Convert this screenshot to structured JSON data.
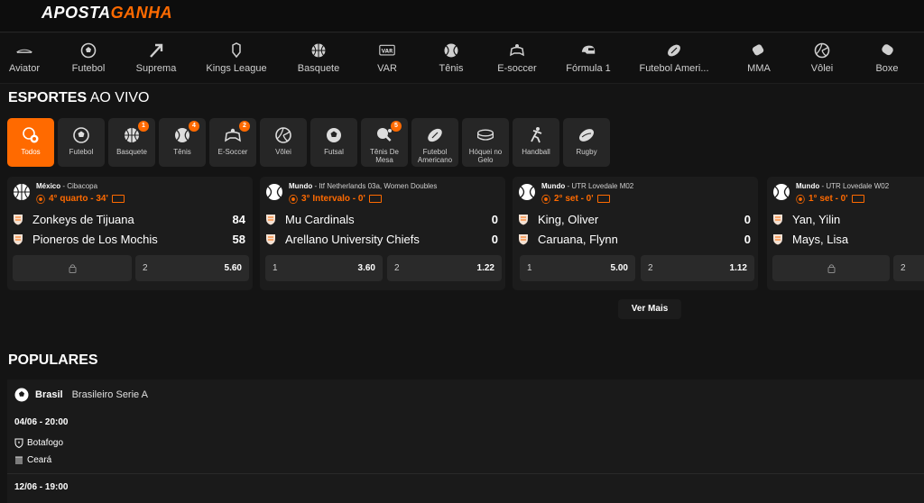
{
  "brand": {
    "part1": "APOSTA",
    "part2": "GANHA"
  },
  "colors": {
    "accent": "#ff6a00",
    "background": "#141414",
    "card": "#1c1c1c"
  },
  "nav": [
    {
      "label": "Aviator",
      "icon": "plane-icon"
    },
    {
      "label": "Futebol",
      "icon": "soccer-ball-icon"
    },
    {
      "label": "Suprema",
      "icon": "arrow-up-icon"
    },
    {
      "label": "Kings League",
      "icon": "kings-league-icon"
    },
    {
      "label": "Basquete",
      "icon": "basketball-icon"
    },
    {
      "label": "VAR",
      "icon": "var-icon"
    },
    {
      "label": "Tênis",
      "icon": "tennis-ball-icon"
    },
    {
      "label": "E-soccer",
      "icon": "gamepad-icon"
    },
    {
      "label": "Fórmula 1",
      "icon": "helmet-icon"
    },
    {
      "label": "Futebol Ameri...",
      "icon": "american-football-icon"
    },
    {
      "label": "MMA",
      "icon": "glove-icon"
    },
    {
      "label": "Vôlei",
      "icon": "volleyball-icon"
    },
    {
      "label": "Boxe",
      "icon": "boxing-glove-icon"
    }
  ],
  "live": {
    "title_bold": "ESPORTES",
    "title_rest": " AO VIVO"
  },
  "chips": [
    {
      "label": "Todos",
      "badge": ""
    },
    {
      "label": "Futebol",
      "badge": ""
    },
    {
      "label": "Basquete",
      "badge": "1"
    },
    {
      "label": "Tênis",
      "badge": "4"
    },
    {
      "label": "E-Soccer",
      "badge": "2"
    },
    {
      "label": "Vôlei",
      "badge": ""
    },
    {
      "label": "Futsal",
      "badge": ""
    },
    {
      "label": "Tênis De Mesa",
      "badge": "5"
    },
    {
      "label": "Futebol Americano",
      "badge": ""
    },
    {
      "label": "Hóquei no Gelo",
      "badge": ""
    },
    {
      "label": "Handball",
      "badge": ""
    },
    {
      "label": "Rugby",
      "badge": ""
    }
  ],
  "matches": [
    {
      "country": "México",
      "league": " - Cibacopa",
      "time": "4° quarto - 34'",
      "team1": "Zonkeys de Tijuana",
      "score1": "84",
      "team2": "Pioneros de Los Mochis",
      "score2": "58",
      "odd1": {
        "locked": true,
        "k": "",
        "v": ""
      },
      "odd2": {
        "locked": false,
        "k": "2",
        "v": "5.60"
      }
    },
    {
      "country": "Mundo",
      "league": " - Itf Netherlands 03a, Women Doubles",
      "time": "3° Intervalo - 0'",
      "team1": "Mu Cardinals",
      "score1": "0",
      "team2": "Arellano University Chiefs",
      "score2": "0",
      "odd1": {
        "locked": false,
        "k": "1",
        "v": "3.60"
      },
      "odd2": {
        "locked": false,
        "k": "2",
        "v": "1.22"
      }
    },
    {
      "country": "Mundo",
      "league": " - UTR Lovedale M02",
      "time": "2° set - 0'",
      "team1": "King, Oliver",
      "score1": "0",
      "team2": "Caruana, Flynn",
      "score2": "0",
      "odd1": {
        "locked": false,
        "k": "1",
        "v": "5.00"
      },
      "odd2": {
        "locked": false,
        "k": "2",
        "v": "1.12"
      }
    },
    {
      "country": "Mundo",
      "league": " - UTR Lovedale W02",
      "time": "1° set - 0'",
      "team1": "Yan, Yilin",
      "score1": "",
      "team2": "Mays, Lisa",
      "score2": "",
      "odd1": {
        "locked": true,
        "k": "",
        "v": ""
      },
      "odd2": {
        "locked": false,
        "k": "2",
        "v": ""
      }
    }
  ],
  "ver_mais": "Ver Mais",
  "popular": {
    "title": "POPULARES",
    "country": "Brasil",
    "league": "Brasileiro Serie A",
    "game1": {
      "date": "04/06 - 20:00",
      "team1": "Botafogo",
      "team2": "Ceará"
    },
    "game2": {
      "date": "12/06 - 19:00"
    }
  }
}
